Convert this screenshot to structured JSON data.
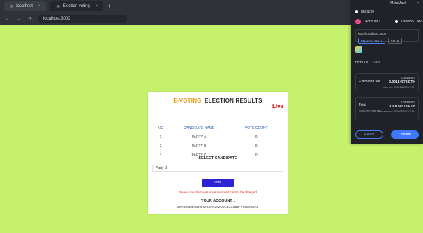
{
  "browser": {
    "tabs": [
      {
        "label": "localhost"
      },
      {
        "label": "Election voting"
      }
    ],
    "address": "localhost:3000"
  },
  "page": {
    "title_evoting": "E-VOTING",
    "title_rest": "ELECTION RESULTS",
    "live": "Live",
    "table": {
      "headers": [
        "NO",
        "CANDIDATE NAME",
        "VOTE COUNT"
      ],
      "rows": [
        [
          "1",
          "PARTY A",
          "0"
        ],
        [
          "2",
          "PARTY B",
          "0"
        ],
        [
          "3",
          "PARTY C",
          "0"
        ]
      ]
    },
    "select_title": "SELECT CANDIDATE",
    "select_value": "Party B",
    "vote_label": "Vote",
    "note": "Please note that vote once recorded cannot be changed",
    "account_label": "YOUR ACCOUNT :",
    "account_value": "0XA9A6E4A2B9F0F2BA4282D0CE3C5B8F4F8B8B8A8"
  },
  "metamask": {
    "title": "MetaMask",
    "network": "ganache",
    "account_from": "Account 1",
    "account_to": "0x0ef55...4f2",
    "site_url": "http://localhost:3000",
    "contract": "0xD3F6...8BC7",
    "method": "VOTE",
    "tab_details": "DETAILS",
    "tab_hex": "HEX",
    "estimated_fee_label": "Estimated fee",
    "estimated_fee_usd": "0.0015457",
    "estimated_fee_eth": "0.00154578 ETH",
    "estimated_fee_max": "Max fee: 0.00154578 ETH",
    "total_label": "Total",
    "total_sub": "Amount + gas fee",
    "total_usd": "0.0015457",
    "total_eth": "0.00154578 ETH",
    "total_max": "Max amount: 0.00154578 ETH",
    "reject": "Reject",
    "confirm": "Confirm"
  }
}
